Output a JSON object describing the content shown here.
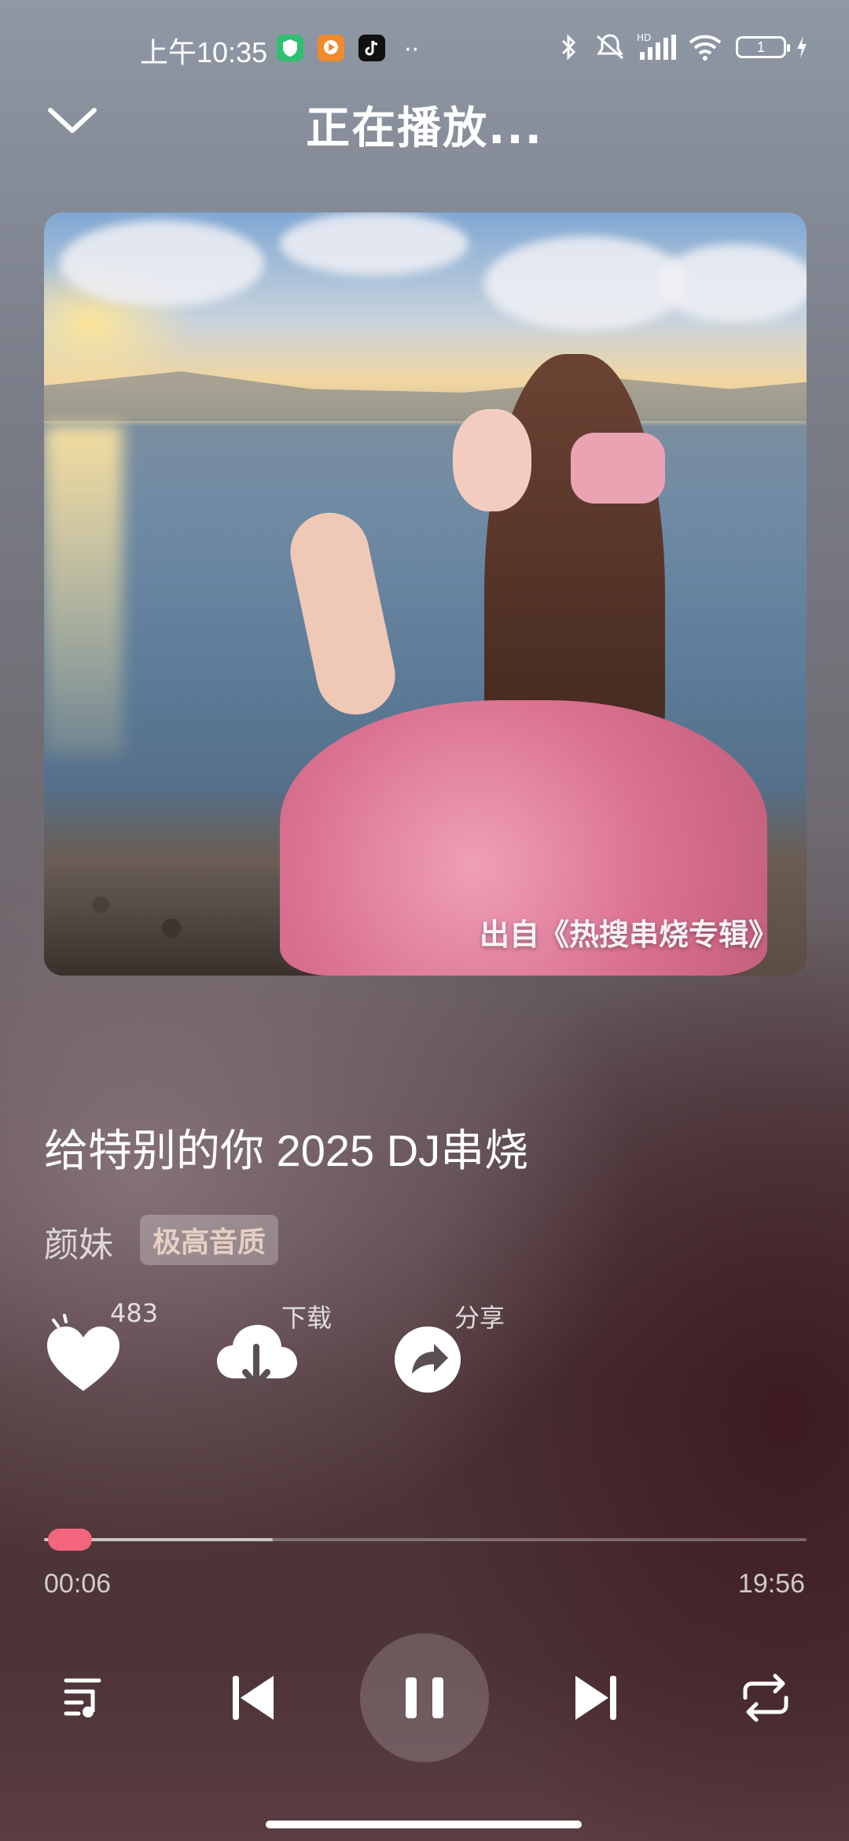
{
  "status_bar": {
    "time": "上午10:35",
    "battery": "1",
    "icons": [
      "shield-app-icon",
      "video-app-icon",
      "tiktok-icon",
      "more-dots-icon",
      "bluetooth-icon",
      "mute-icon",
      "hd-signal-icon",
      "wifi-icon",
      "battery-icon",
      "charging-icon"
    ]
  },
  "header": {
    "title": "正在播放..."
  },
  "cover": {
    "caption": "出自《热搜串烧专辑》"
  },
  "song": {
    "title": "给特别的你 2025 DJ串烧",
    "artist": "颜妹",
    "quality_badge": "极高音质"
  },
  "actions": {
    "like_count": "483",
    "download_label": "下载",
    "share_label": "分享"
  },
  "progress": {
    "current": "00:06",
    "total": "19:56",
    "played_fraction": 0.005,
    "buffered_fraction": 0.3
  },
  "colors": {
    "accent": "#f2657d"
  }
}
